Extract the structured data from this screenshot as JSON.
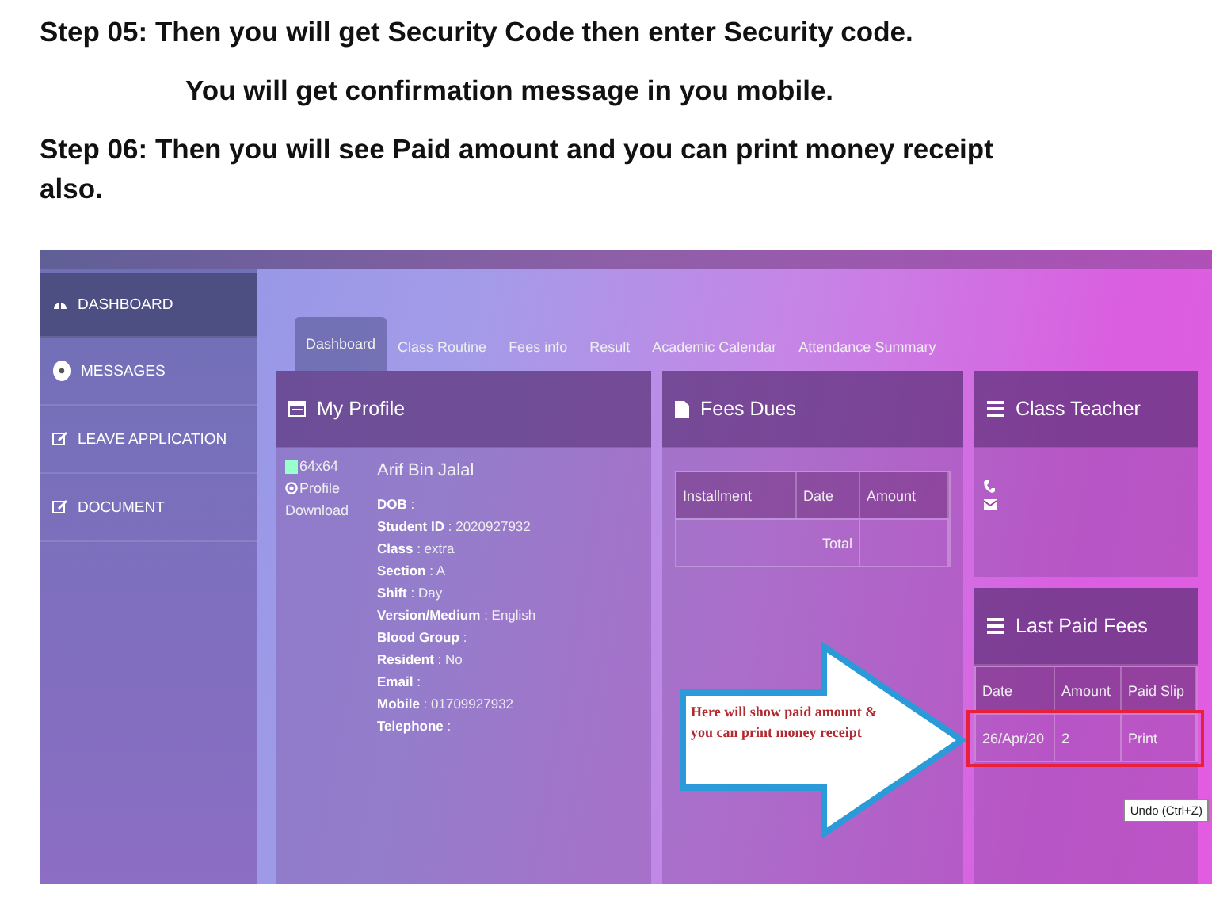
{
  "instructions": [
    {
      "text": "Step 05: Then you will get Security Code then enter Security code.",
      "indented": false
    },
    {
      "text": "You will get confirmation message in you mobile.",
      "indented": true
    },
    {
      "text": "Step 06: Then you will see Paid amount and you can print money receipt also.",
      "indented": false
    }
  ],
  "screenshot": {
    "sidebar": {
      "items": [
        {
          "label": "DASHBOARD",
          "selected": true
        },
        {
          "label": "MESSAGES",
          "selected": false
        },
        {
          "label": "LEAVE APPLICATION",
          "selected": false
        },
        {
          "label": "DOCUMENT",
          "selected": false
        }
      ]
    },
    "tabs": [
      {
        "label": "Dashboard",
        "selected": true
      },
      {
        "label": "Class Routine",
        "selected": false
      },
      {
        "label": "Fees info",
        "selected": false
      },
      {
        "label": "Result",
        "selected": false
      },
      {
        "label": "Academic Calendar",
        "selected": false
      },
      {
        "label": "Attendance Summary",
        "selected": false
      }
    ],
    "my_profile": {
      "title": "My Profile",
      "photo_alt": "64x64",
      "photo_link": "Profile",
      "download": "Download",
      "name": "Arif Bin Jalal",
      "fields": [
        {
          "label": "DOB",
          "value": ":"
        },
        {
          "label": "Student ID",
          "value": ": 2020927932"
        },
        {
          "label": "Class",
          "value": ": extra"
        },
        {
          "label": "Section",
          "value": ": A"
        },
        {
          "label": "Shift",
          "value": ": Day"
        },
        {
          "label": "Version/Medium",
          "value": ": English"
        },
        {
          "label": "Blood Group",
          "value": ":"
        },
        {
          "label": "Resident",
          "value": ": No"
        },
        {
          "label": "Email",
          "value": ":"
        },
        {
          "label": "Mobile",
          "value": ": 01709927932"
        },
        {
          "label": "Telephone",
          "value": ":"
        }
      ]
    },
    "fees_dues": {
      "title": "Fees Dues",
      "columns": [
        "Installment",
        "Date",
        "Amount"
      ],
      "total_label": "Total"
    },
    "class_teacher": {
      "title": "Class Teacher"
    },
    "last_paid_fees": {
      "title": "Last Paid Fees",
      "columns": [
        "Date",
        "Amount",
        "Paid Slip"
      ],
      "rows": [
        {
          "cells": [
            "26/Apr/20",
            "2",
            "Print"
          ],
          "highlighted": true
        }
      ]
    },
    "callout": "Here will show paid amount & you can print money receipt",
    "tooltip": "Undo (Ctrl+Z)"
  }
}
